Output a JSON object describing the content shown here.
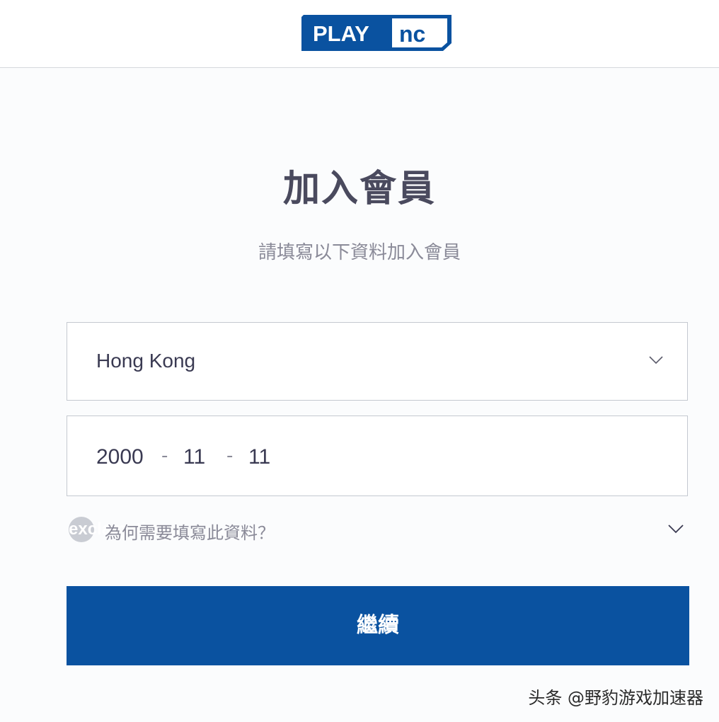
{
  "header": {
    "logo_text": "PLAY",
    "logo_mark": "nc"
  },
  "main": {
    "title": "加入會員",
    "subtitle": "請填寫以下資料加入會員"
  },
  "country_select": {
    "value": "Hong Kong",
    "icon": "chevron-down-icon"
  },
  "birth_date": {
    "year": "2000",
    "month": "11",
    "day": "11",
    "separator": "-"
  },
  "why_info": {
    "icon": "exclamation",
    "icon_name": "info-icon",
    "label": "為何需要填寫此資料？"
  },
  "continue_button": {
    "label": "繼續"
  },
  "watermark": {
    "text": "头条 @野豹游戏加速器"
  },
  "colors": {
    "brand_blue": "#0a52a0",
    "title_text": "#4a4a5e",
    "muted_text": "#8a8a98",
    "border": "#c4c9d0"
  }
}
